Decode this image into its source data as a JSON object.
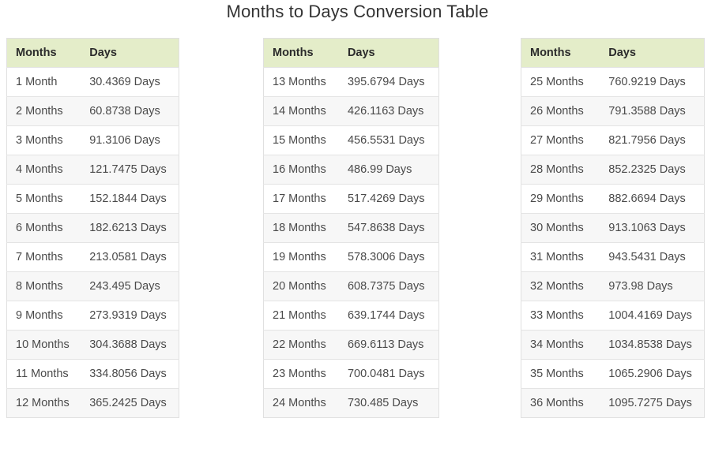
{
  "page": {
    "title": "Months to Days Conversion Table",
    "background_color": "#ffffff",
    "header_background_color": "#e4edc9",
    "row_alt_background_color": "#f7f7f7",
    "border_color": "#e0e0e0",
    "text_color": "#4a4a4a",
    "title_color": "#333333"
  },
  "columns": {
    "months": "Months",
    "days": "Days"
  },
  "tables": [
    {
      "headers": [
        "Months",
        "Days"
      ],
      "rows": [
        [
          "1 Month",
          "30.4369 Days"
        ],
        [
          "2 Months",
          "60.8738 Days"
        ],
        [
          "3 Months",
          "91.3106 Days"
        ],
        [
          "4 Months",
          "121.7475 Days"
        ],
        [
          "5 Months",
          "152.1844 Days"
        ],
        [
          "6 Months",
          "182.6213 Days"
        ],
        [
          "7 Months",
          "213.0581 Days"
        ],
        [
          "8 Months",
          "243.495 Days"
        ],
        [
          "9 Months",
          "273.9319 Days"
        ],
        [
          "10 Months",
          "304.3688 Days"
        ],
        [
          "11 Months",
          "334.8056 Days"
        ],
        [
          "12 Months",
          "365.2425 Days"
        ]
      ]
    },
    {
      "headers": [
        "Months",
        "Days"
      ],
      "rows": [
        [
          "13 Months",
          "395.6794 Days"
        ],
        [
          "14 Months",
          "426.1163 Days"
        ],
        [
          "15 Months",
          "456.5531 Days"
        ],
        [
          "16 Months",
          "486.99 Days"
        ],
        [
          "17 Months",
          "517.4269 Days"
        ],
        [
          "18 Months",
          "547.8638 Days"
        ],
        [
          "19 Months",
          "578.3006 Days"
        ],
        [
          "20 Months",
          "608.7375 Days"
        ],
        [
          "21 Months",
          "639.1744 Days"
        ],
        [
          "22 Months",
          "669.6113 Days"
        ],
        [
          "23 Months",
          "700.0481 Days"
        ],
        [
          "24 Months",
          "730.485 Days"
        ]
      ]
    },
    {
      "headers": [
        "Months",
        "Days"
      ],
      "rows": [
        [
          "25 Months",
          "760.9219 Days"
        ],
        [
          "26 Months",
          "791.3588 Days"
        ],
        [
          "27 Months",
          "821.7956 Days"
        ],
        [
          "28 Months",
          "852.2325 Days"
        ],
        [
          "29 Months",
          "882.6694 Days"
        ],
        [
          "30 Months",
          "913.1063 Days"
        ],
        [
          "31 Months",
          "943.5431 Days"
        ],
        [
          "32 Months",
          "973.98 Days"
        ],
        [
          "33 Months",
          "1004.4169 Days"
        ],
        [
          "34 Months",
          "1034.8538 Days"
        ],
        [
          "35 Months",
          "1065.2906 Days"
        ],
        [
          "36 Months",
          "1095.7275 Days"
        ]
      ]
    }
  ],
  "chart_data": {
    "type": "table",
    "title": "Months to Days Conversion Table",
    "columns": [
      "Months",
      "Days"
    ],
    "xlabel": "Months",
    "ylabel": "Days",
    "x": [
      1,
      2,
      3,
      4,
      5,
      6,
      7,
      8,
      9,
      10,
      11,
      12,
      13,
      14,
      15,
      16,
      17,
      18,
      19,
      20,
      21,
      22,
      23,
      24,
      25,
      26,
      27,
      28,
      29,
      30,
      31,
      32,
      33,
      34,
      35,
      36
    ],
    "values": [
      30.4369,
      60.8738,
      91.3106,
      121.7475,
      152.1844,
      182.6213,
      213.0581,
      243.495,
      273.9319,
      304.3688,
      334.8056,
      365.2425,
      395.6794,
      426.1163,
      456.5531,
      486.99,
      517.4269,
      547.8638,
      578.3006,
      608.7375,
      639.1744,
      669.6113,
      700.0481,
      730.485,
      760.9219,
      791.3588,
      821.7956,
      852.2325,
      882.6694,
      913.1063,
      943.5431,
      973.98,
      1004.4169,
      1034.8538,
      1065.2906,
      1095.7275
    ]
  }
}
